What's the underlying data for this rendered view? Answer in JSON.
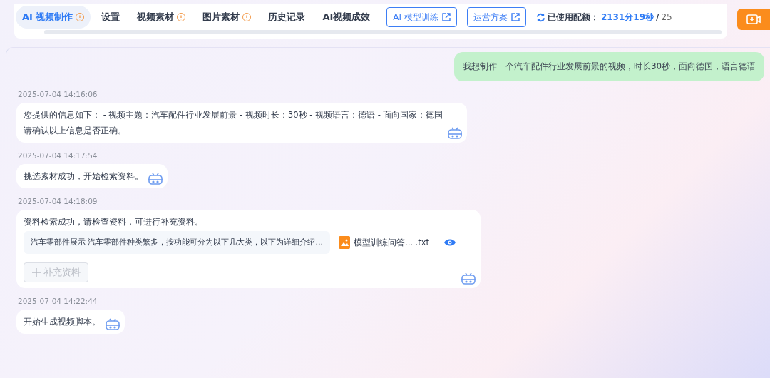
{
  "tabs": [
    {
      "label": "AI 视频制作",
      "selected": true,
      "alert": true
    },
    {
      "label": "设置",
      "selected": false,
      "alert": false
    },
    {
      "label": "视频素材",
      "selected": false,
      "alert": true
    },
    {
      "label": "图片素材",
      "selected": false,
      "alert": true
    },
    {
      "label": "历史记录",
      "selected": false,
      "alert": false
    },
    {
      "label": "AI视频成效",
      "selected": false,
      "alert": false
    }
  ],
  "link_buttons": [
    "AI 模型训练",
    "运营方案"
  ],
  "quota": {
    "label": "已使用配额：",
    "used": "2131分19秒",
    "separator": "/",
    "total": "25"
  },
  "chat": [
    {
      "kind": "user",
      "text": "我想制作一个汽车配件行业发展前景的视频，时长30秒，面向德国，语言德语"
    },
    {
      "kind": "bot",
      "time": "2025-07-04 14:16:06",
      "lines": [
        "您提供的信息如下： - 视频主题：汽车配件行业发展前景 - 视频时长：30秒 - 视频语言：德语 - 面向国家：德国",
        "请确认以上信息是否正确。"
      ]
    },
    {
      "kind": "bot",
      "time": "2025-07-04 14:17:54",
      "lines": [
        "挑选素材成功，开始检索资料。"
      ]
    },
    {
      "kind": "bot",
      "time": "2025-07-04 14:18:09",
      "lines": [
        "资料检索成功，请检查资料，可进行补充资料。"
      ],
      "material": {
        "summary": "汽车零部件展示 汽车零部件种类繁多，按功能可分为以下几大类，以下为详细介绍...",
        "file": "模型训练问答... .txt"
      },
      "action": {
        "label": "补充资料",
        "disabled": true
      }
    },
    {
      "kind": "bot",
      "time": "2025-07-04 14:22:44",
      "lines": [
        "开始生成视频脚本。"
      ]
    }
  ]
}
